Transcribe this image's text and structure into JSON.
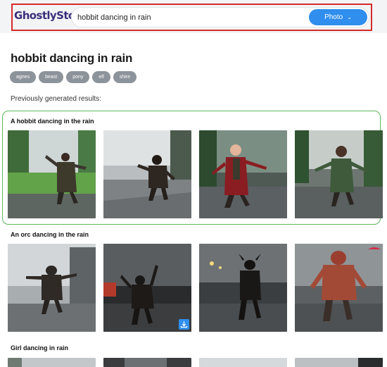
{
  "header": {
    "logo": "GhostlyStock",
    "search_value": "hobbit dancing in rain",
    "type_label": "Photo",
    "type_chevron": "⌄"
  },
  "page": {
    "title": "hobbit dancing in rain",
    "tags": [
      "agnes",
      "beast",
      "pony",
      "elf",
      "shire"
    ],
    "previous_label": "Previously generated results:"
  },
  "groups": [
    {
      "title": "A hobbit dancing in the rain",
      "images": [
        "hobbit-photo",
        "hobbit-photo",
        "hobbit-photo",
        "hobbit-photo"
      ]
    },
    {
      "title": "An orc dancing in the rain",
      "images": [
        "orc-photo",
        "orc-photo",
        "orc-photo",
        "orc-photo"
      ]
    },
    {
      "title": "Girl dancing in rain",
      "images": [
        "girl-photo",
        "girl-photo",
        "girl-photo",
        "girl-photo"
      ]
    }
  ],
  "icons": {
    "download": "download-icon",
    "chevron": "chevron-down-icon"
  },
  "colors": {
    "accent": "#2f8eee",
    "tag": "#8c939a",
    "highlight_green": "#5cb85c",
    "outline_red": "#d42b2b"
  }
}
